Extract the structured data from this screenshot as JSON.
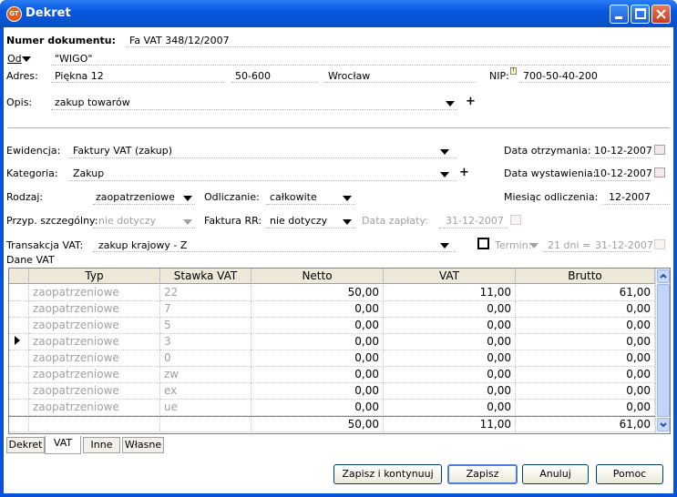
{
  "window": {
    "title": "Dekret",
    "icon_text": "GT"
  },
  "header": {
    "doc_number_label": "Numer dokumentu:",
    "doc_number": "Fa VAT 348/12/2007",
    "od_label": "Od",
    "od_value": "\"WIGO\"",
    "address_label": "Adres:",
    "street": "Piękna 12",
    "postal": "50-600",
    "city": "Wrocław",
    "nip_label": "NIP:",
    "nip": "700-50-40-200",
    "opis_label": "Opis:",
    "opis": "zakup towarów"
  },
  "form": {
    "ewidencja_label": "Ewidencja:",
    "ewidencja": "Faktury VAT (zakup)",
    "kategoria_label": "Kategoria:",
    "kategoria": "Zakup",
    "rodzaj_label": "Rodzaj:",
    "rodzaj": "zaopatrzeniowe",
    "odliczanie_label": "Odliczanie:",
    "odliczanie": "całkowite",
    "przyp_label": "Przyp. szczególny:",
    "przyp": "nie dotyczy",
    "faktura_rr_label": "Faktura RR:",
    "faktura_rr": "nie dotyczy",
    "data_zaplaty_label": "Data zapłaty:",
    "data_zaplaty": "31-12-2007",
    "transakcja_label": "Transakcja VAT:",
    "transakcja": "zakup krajowy - Z",
    "termin_label": "Termin:",
    "termin_days": "21 dni =",
    "termin_date": "31-12-2007",
    "data_otrzymania_label": "Data otrzymania:",
    "data_otrzymania": "10-12-2007",
    "data_wystawienia_label": "Data wystawienia:",
    "data_wystawienia": "10-12-2007",
    "miesiac_label": "Miesiąc odliczenia:",
    "miesiac": "12-2007",
    "dane_vat_label": "Dane VAT"
  },
  "grid": {
    "columns": [
      "Typ",
      "Stawka VAT",
      "Netto",
      "VAT",
      "Brutto"
    ],
    "rows": [
      [
        "zaopatrzeniowe",
        "22",
        "50,00",
        "11,00",
        "61,00"
      ],
      [
        "zaopatrzeniowe",
        "7",
        "0,00",
        "0,00",
        "0,00"
      ],
      [
        "zaopatrzeniowe",
        "5",
        "0,00",
        "0,00",
        "0,00"
      ],
      [
        "zaopatrzeniowe",
        "3",
        "0,00",
        "0,00",
        "0,00"
      ],
      [
        "zaopatrzeniowe",
        "0",
        "0,00",
        "0,00",
        "0,00"
      ],
      [
        "zaopatrzeniowe",
        "zw",
        "0,00",
        "0,00",
        "0,00"
      ],
      [
        "zaopatrzeniowe",
        "ex",
        "0,00",
        "0,00",
        "0,00"
      ],
      [
        "zaopatrzeniowe",
        "ue",
        "0,00",
        "0,00",
        "0,00"
      ]
    ],
    "totals": [
      "50,00",
      "11,00",
      "61,00"
    ]
  },
  "tabs": [
    "Dekret",
    "VAT",
    "Inne",
    "Własne"
  ],
  "buttons": {
    "save_continue": "Zapisz i kontynuuj",
    "save": "Zapisz",
    "cancel": "Anuluj",
    "help": "Pomoc"
  },
  "colors": {
    "titlebar": "#0a50d8",
    "disabled_text": "#a0a0a0"
  }
}
